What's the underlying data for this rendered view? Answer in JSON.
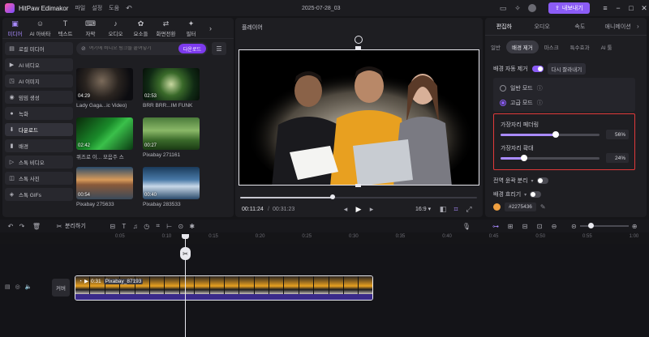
{
  "app": {
    "name": "HitPaw Edimakor",
    "menu": [
      "파일",
      "설정",
      "도움"
    ],
    "project_title": "2025-07-28_03",
    "export_label": "내보내기"
  },
  "media_tabs": [
    {
      "label": "미디어",
      "icon": "▣"
    },
    {
      "label": "AI 아바타",
      "icon": "☺"
    },
    {
      "label": "텍스트",
      "icon": "T"
    },
    {
      "label": "자막",
      "icon": "⌨"
    },
    {
      "label": "오디오",
      "icon": "♪"
    },
    {
      "label": "요소들",
      "icon": "✿"
    },
    {
      "label": "화면전환",
      "icon": "⇄"
    },
    {
      "label": "필터",
      "icon": "✦"
    },
    {
      "label": "",
      "icon": "›"
    }
  ],
  "sidenav": [
    {
      "label": "로컬 미디어",
      "icon": "▤"
    },
    {
      "label": "AI 비디오",
      "icon": "▶"
    },
    {
      "label": "AI 이미지",
      "icon": "◳"
    },
    {
      "label": "밈밈 생성",
      "icon": "◉"
    },
    {
      "label": "녹화",
      "icon": "●"
    },
    {
      "label": "다운로드",
      "icon": "⬇"
    },
    {
      "label": "배경",
      "icon": "▮"
    },
    {
      "label": "스톡 비디오",
      "icon": "▷"
    },
    {
      "label": "스톡 사진",
      "icon": "◫"
    },
    {
      "label": "스톡 GIFs",
      "icon": "◈"
    }
  ],
  "search": {
    "placeholder": "여기에 비디오 링크를 붙여넣기",
    "download_label": "다운로드"
  },
  "media_items": [
    {
      "duration": "04:29",
      "caption": "Lady Gaga...ic Video)"
    },
    {
      "duration": "02:53",
      "caption": "BRR BRR...IM FUNK"
    },
    {
      "duration": "02:42",
      "caption": "퀴즈로 이... 모음주 스"
    },
    {
      "duration": "00:27",
      "caption": "Pixabay 271161"
    },
    {
      "duration": "00:54",
      "caption": "Pixabay 275633"
    },
    {
      "duration": "00:40",
      "caption": "Pixabay 283533"
    }
  ],
  "preview": {
    "label": "플레이어",
    "current_time": "00:11:24",
    "total_time": "00:31:23",
    "aspect": "16:9",
    "progress": 0.39
  },
  "right_panel": {
    "tabs": [
      "편집하",
      "오디오",
      "속도",
      "애니메이션"
    ],
    "subtabs": [
      "일반",
      "배경 제거",
      "마스크",
      "특수효과",
      "AI 툴"
    ],
    "bg_remove_label": "배경 자동 제거",
    "redo_label": "다시 잘라내기",
    "normal_mode": "일반 모드",
    "advanced_mode": "고급 모드",
    "edge_feather_label": "가장자리 페더링",
    "edge_feather_value": "56%",
    "edge_feather_level": 0.56,
    "edge_expand_label": "가장자리 확대",
    "edge_expand_value": "24%",
    "edge_expand_level": 0.24,
    "shadow_label": "전역 윤곽 분리",
    "bg_blur_label": "배경 흐리기",
    "color_hex": "#2275436"
  },
  "timeline": {
    "ticks": [
      "0:05",
      "0:10",
      "0:15",
      "0:20",
      "0:25",
      "0:30",
      "0:35",
      "0:40",
      "0:45",
      "0:50",
      "0:55",
      "1:00"
    ],
    "split_label": "분리하기",
    "cover_label": "커버",
    "clip_duration": "0:31",
    "clip_name": "Pixabay_87193"
  }
}
